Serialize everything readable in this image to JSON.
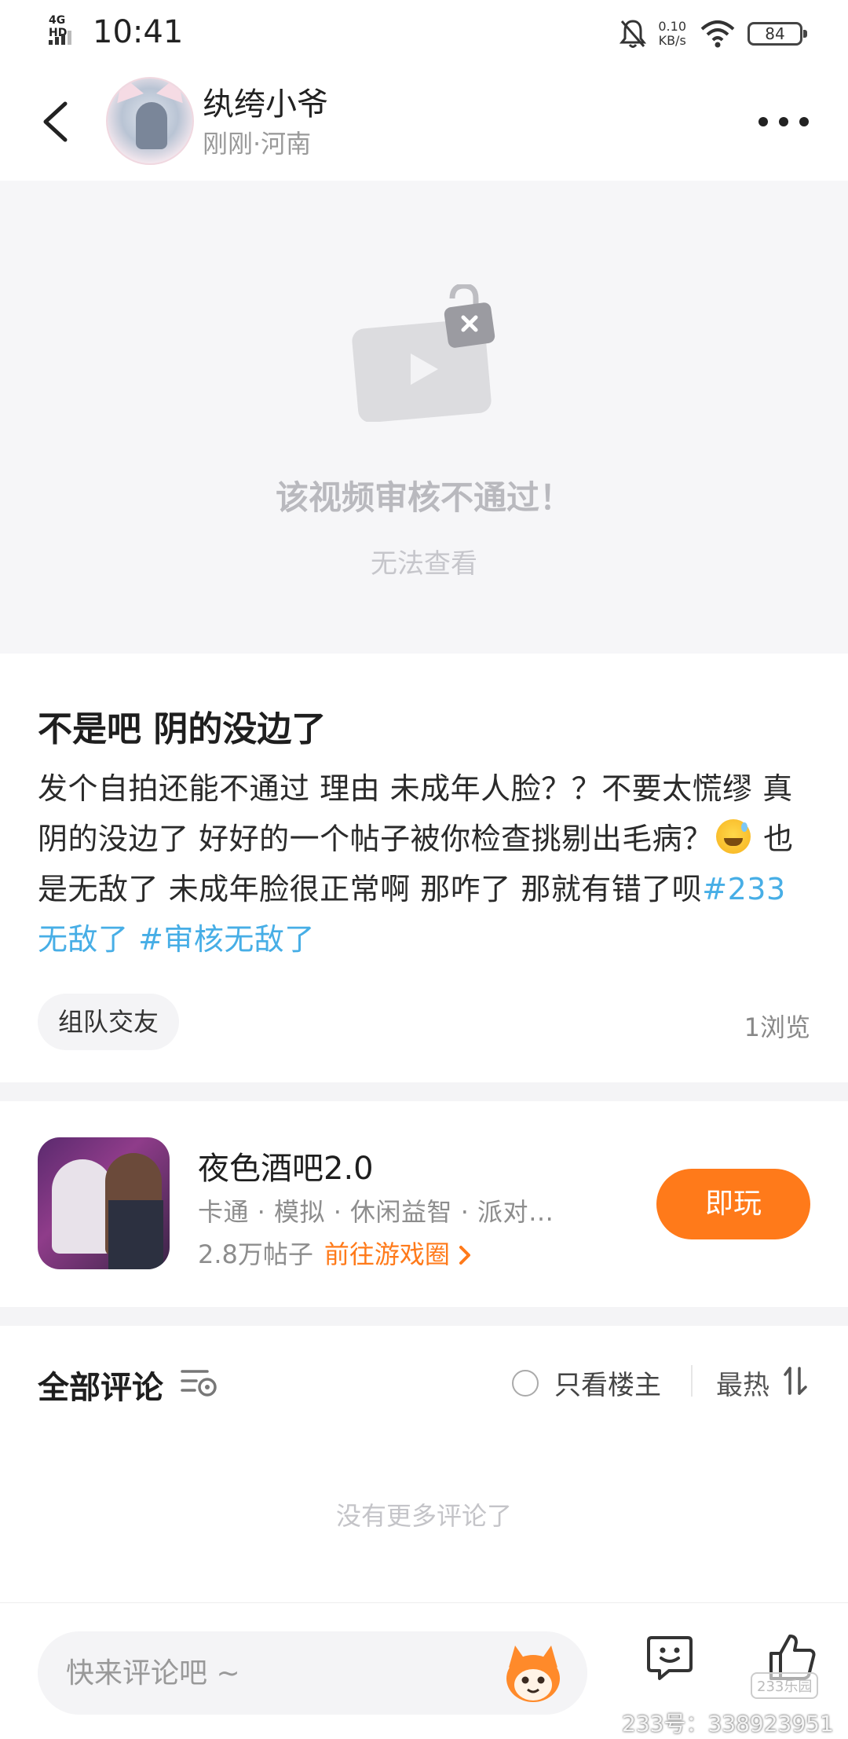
{
  "status_bar": {
    "network": "4G HD",
    "time": "10:41",
    "speed_value": "0.10",
    "speed_unit": "KB/s",
    "battery": "84"
  },
  "header": {
    "author_name": "纨绔小爷",
    "author_meta": "刚刚·河南"
  },
  "video": {
    "title": "该视频审核不通过！",
    "subtitle": "无法查看"
  },
  "post": {
    "title": "不是吧 阴的没边了",
    "body_part1": "发个自拍还能不通过 理由 未成年人脸？？不要太慌缪 真阴的没边了 好好的一个帖子被你检查挑剔出毛病？",
    "body_part2": " 也是无敌了 未成年脸很正常啊 那咋了 那就有错了呗",
    "hashtag1": "#233无敌了",
    "hashtag2": " #审核无敌了",
    "tag": "组队交友",
    "views": "1浏览"
  },
  "game": {
    "name": "夜色酒吧2.0",
    "tags": "卡通 · 模拟 · 休闲益智 · 派对…",
    "posts": "2.8万帖子",
    "link": "前往游戏圈",
    "play": "即玩"
  },
  "comments": {
    "title": "全部评论",
    "only_owner": "只看楼主",
    "sort": "最热",
    "empty": "没有更多评论了"
  },
  "bottom": {
    "placeholder": "快来评论吧 ~",
    "watermark": "233号：338923951",
    "logo": "233乐园"
  },
  "colors": {
    "accent": "#ff7a1a",
    "hashtag": "#47aee6"
  },
  "icons": [
    "back-arrow-icon",
    "more-icon",
    "blocked-video-icon",
    "filter-icon",
    "sort-icon",
    "emoji-icon",
    "like-icon",
    "mascot-icon"
  ]
}
